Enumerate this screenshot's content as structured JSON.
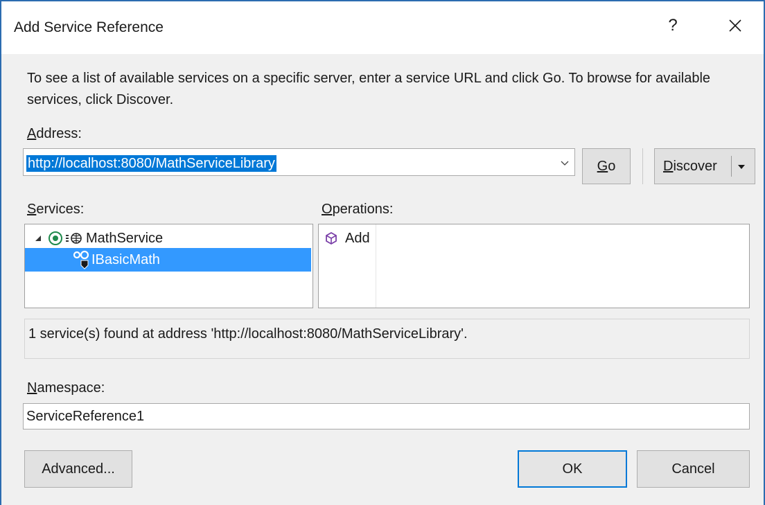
{
  "window": {
    "title": "Add Service Reference",
    "help_label": "?"
  },
  "description": "To see a list of available services on a specific server, enter a service URL and click Go. To browse for available services, click Discover.",
  "address": {
    "label": "Address:",
    "value": "http://localhost:8080/MathServiceLibrary"
  },
  "buttons": {
    "go": "Go",
    "discover": "Discover",
    "advanced": "Advanced...",
    "ok": "OK",
    "cancel": "Cancel"
  },
  "services": {
    "label": "Services:",
    "tree": [
      {
        "label": "MathService",
        "expanded": true
      },
      {
        "label": "IBasicMath",
        "selected": true
      }
    ]
  },
  "operations": {
    "label": "Operations:",
    "items": [
      "Add"
    ]
  },
  "status": "1 service(s) found at address 'http://localhost:8080/MathServiceLibrary'.",
  "namespace": {
    "label": "Namespace:",
    "value": "ServiceReference1"
  },
  "colors": {
    "accent": "#0078d7",
    "selection": "#3399ff",
    "window_border": "#2b6cb0",
    "dialog_bg": "#f0f0f0"
  }
}
